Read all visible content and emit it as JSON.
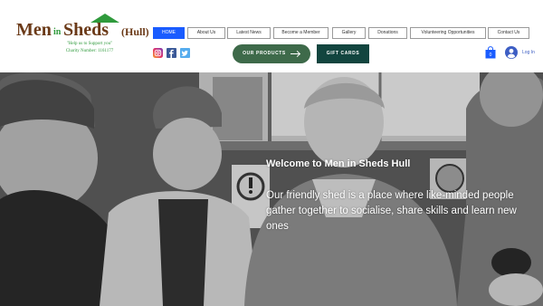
{
  "logo": {
    "word_men": "Men",
    "word_in": "in",
    "word_sheds": "Sheds",
    "word_hull": "(Hull)",
    "tagline": "\"Help us to Support you\"",
    "charity": "Charity Number: 1161177"
  },
  "nav": {
    "items": [
      {
        "label": "HOME",
        "active": true
      },
      {
        "label": "About Us"
      },
      {
        "label": "Latest News"
      },
      {
        "label": "Become a Member"
      },
      {
        "label": "Gallery"
      },
      {
        "label": "Donations"
      },
      {
        "label": "Volunteering Opportunities"
      },
      {
        "label": "Contact Us"
      }
    ]
  },
  "social": {
    "instagram": "instagram-icon",
    "facebook": "facebook-icon",
    "twitter": "twitter-icon"
  },
  "buttons": {
    "products": "OUR PRODUCTS",
    "gift_cards": "GIFT CARDS"
  },
  "account": {
    "cart_count": "0",
    "login": "Log In"
  },
  "hero": {
    "title": "Welcome to Men in Sheds Hull",
    "body": "Our friendly shed is a place where like-minded people gather together to socialise, share skills and learn new ones"
  },
  "colors": {
    "nav_active": "#1a5cff",
    "products_button": "#3e6a4a",
    "gift_button": "#12453f",
    "logo_brown": "#6b3a18",
    "logo_green": "#2f9a3c",
    "cart_blue": "#1a5cff"
  }
}
